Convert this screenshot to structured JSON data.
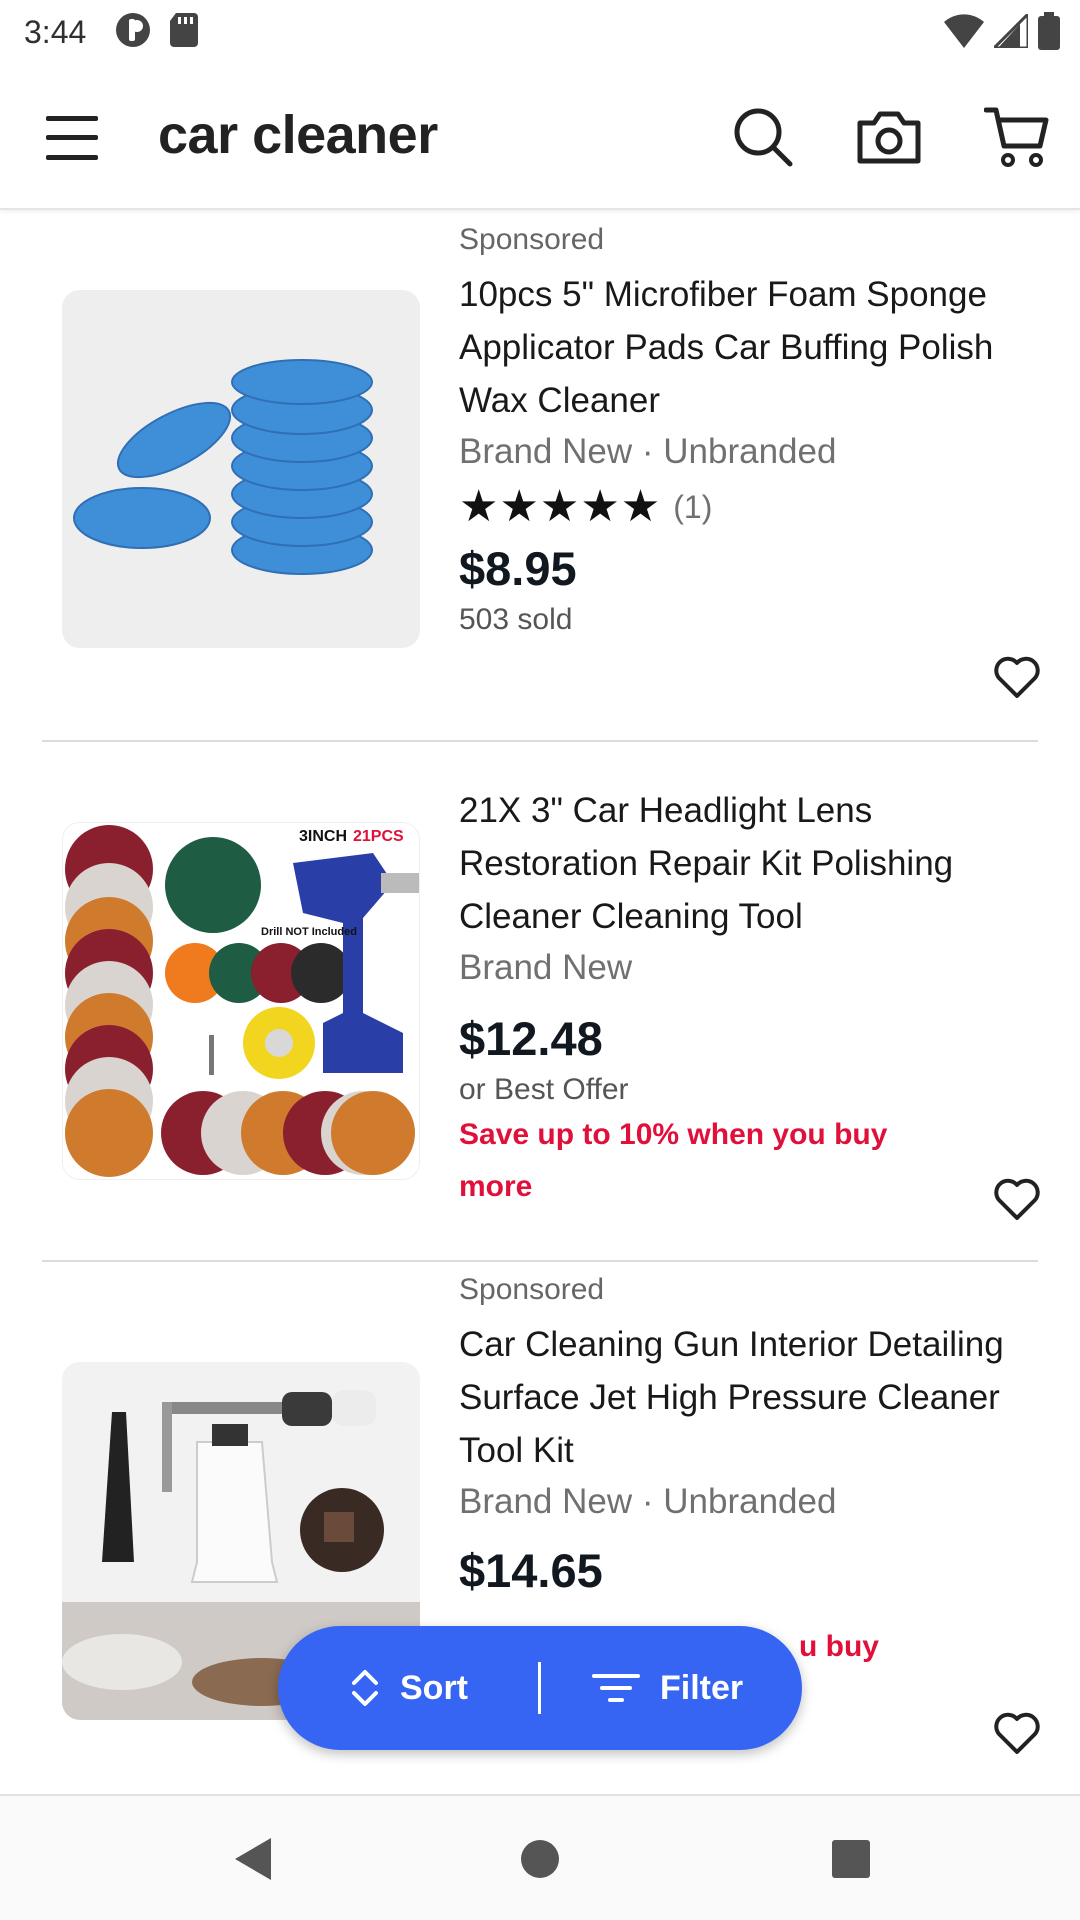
{
  "status_bar": {
    "time": "3:44"
  },
  "app_bar": {
    "search_query": "car cleaner",
    "icons": [
      "menu-icon",
      "search-icon",
      "camera-icon",
      "cart-icon"
    ]
  },
  "listings": [
    {
      "sponsored": "Sponsored",
      "title": "10pcs 5\" Microfiber Foam Sponge Applicator Pads Car Buffing Polish Wax Cleaner",
      "condition": "Brand New · Unbranded",
      "stars": "★★★★★",
      "rating_count": "(1)",
      "price": "$8.95",
      "sold": "503 sold"
    },
    {
      "title": "21X 3\" Car Headlight Lens Restoration Repair Kit Polishing Cleaner Cleaning Tool",
      "condition": "Brand New",
      "price": "$12.48",
      "best_offer": "or Best Offer",
      "promo": "Save up to 10% when you buy more",
      "image_text_1": "3INCH",
      "image_text_2": "21PCS",
      "image_text_3": "Drill NOT Included"
    },
    {
      "sponsored": "Sponsored",
      "title": "Car Cleaning Gun Interior Detailing Surface Jet High Pressure Cleaner Tool Kit",
      "condition": "Brand New · Unbranded",
      "price": "$14.65",
      "promo_partial": "u buy"
    }
  ],
  "sort_filter": {
    "sort_label": "Sort",
    "filter_label": "Filter",
    "color": "#3665f3"
  },
  "colors": {
    "promo": "#e0103a",
    "text": "#111820",
    "secondary": "#707070"
  }
}
